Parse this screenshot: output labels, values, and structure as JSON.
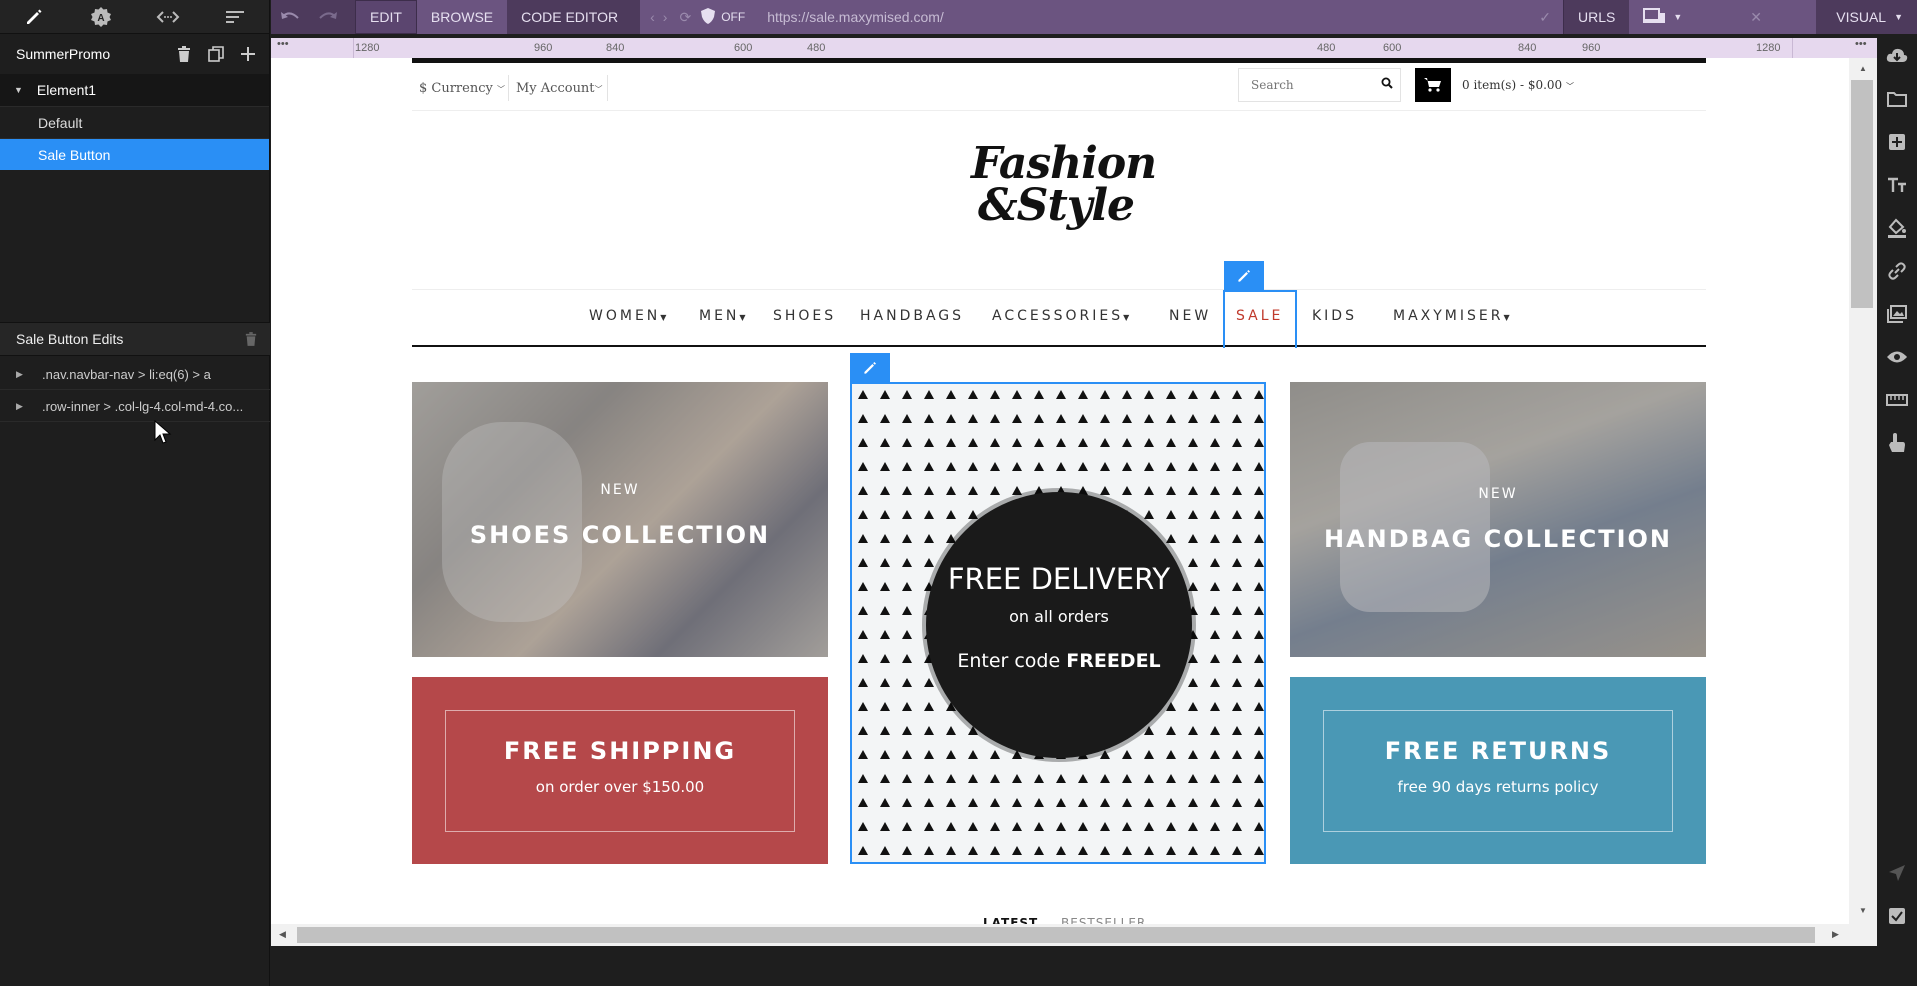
{
  "experience": {
    "name": "SummerPromo"
  },
  "tree": {
    "element": "Element1",
    "variations": [
      "Default",
      "Sale Button"
    ]
  },
  "edits": {
    "title": "Sale Button Edits",
    "items": [
      ".nav.navbar-nav > li:eq(6) > a",
      ".row-inner > .col-lg-4.col-md-4.co..."
    ]
  },
  "toolbar": {
    "edit": "EDIT",
    "browse": "BROWSE",
    "code_editor": "CODE EDITOR",
    "off": "OFF",
    "url": "https://sale.maxymised.com/",
    "urls": "URLS",
    "visual": "VISUAL"
  },
  "ruler": {
    "left": [
      "1280",
      "960",
      "840",
      "600",
      "480"
    ],
    "right": [
      "480",
      "600",
      "840",
      "960",
      "1280"
    ]
  },
  "site": {
    "currency": "$ Currency",
    "account": "My Account",
    "search_placeholder": "Search",
    "cart_count": "0",
    "cart_text": "item(s) - $0.00",
    "logo_line1": "Fashion",
    "logo_line2": "&Style",
    "nav": [
      "WOMEN",
      "MEN",
      "SHOES",
      "HANDBAGS",
      "ACCESSORIES",
      "NEW",
      "SALE",
      "KIDS",
      "MAXYMISER"
    ],
    "tiles": {
      "shoes": {
        "new": "NEW",
        "title": "SHOES COLLECTION"
      },
      "handbags": {
        "new": "NEW",
        "title": "HANDBAG COLLECTION"
      },
      "delivery": {
        "title": "FREE DELIVERY",
        "sub": "on all orders",
        "code_prefix": "Enter code",
        "code": "FREEDEL"
      },
      "shipping": {
        "title": "FREE SHIPPING",
        "sub": "on order over $150.00"
      },
      "returns": {
        "title": "FREE RETURNS",
        "sub": "free 90 days returns policy"
      }
    },
    "bottom_tabs": [
      "LATEST",
      "BESTSELLER"
    ]
  },
  "colors": {
    "accent": "#2a8ff5",
    "topbar": "#4d3a5c",
    "sale": "#c0392b",
    "shipping": "#b5484a",
    "returns": "#4a98b5"
  }
}
